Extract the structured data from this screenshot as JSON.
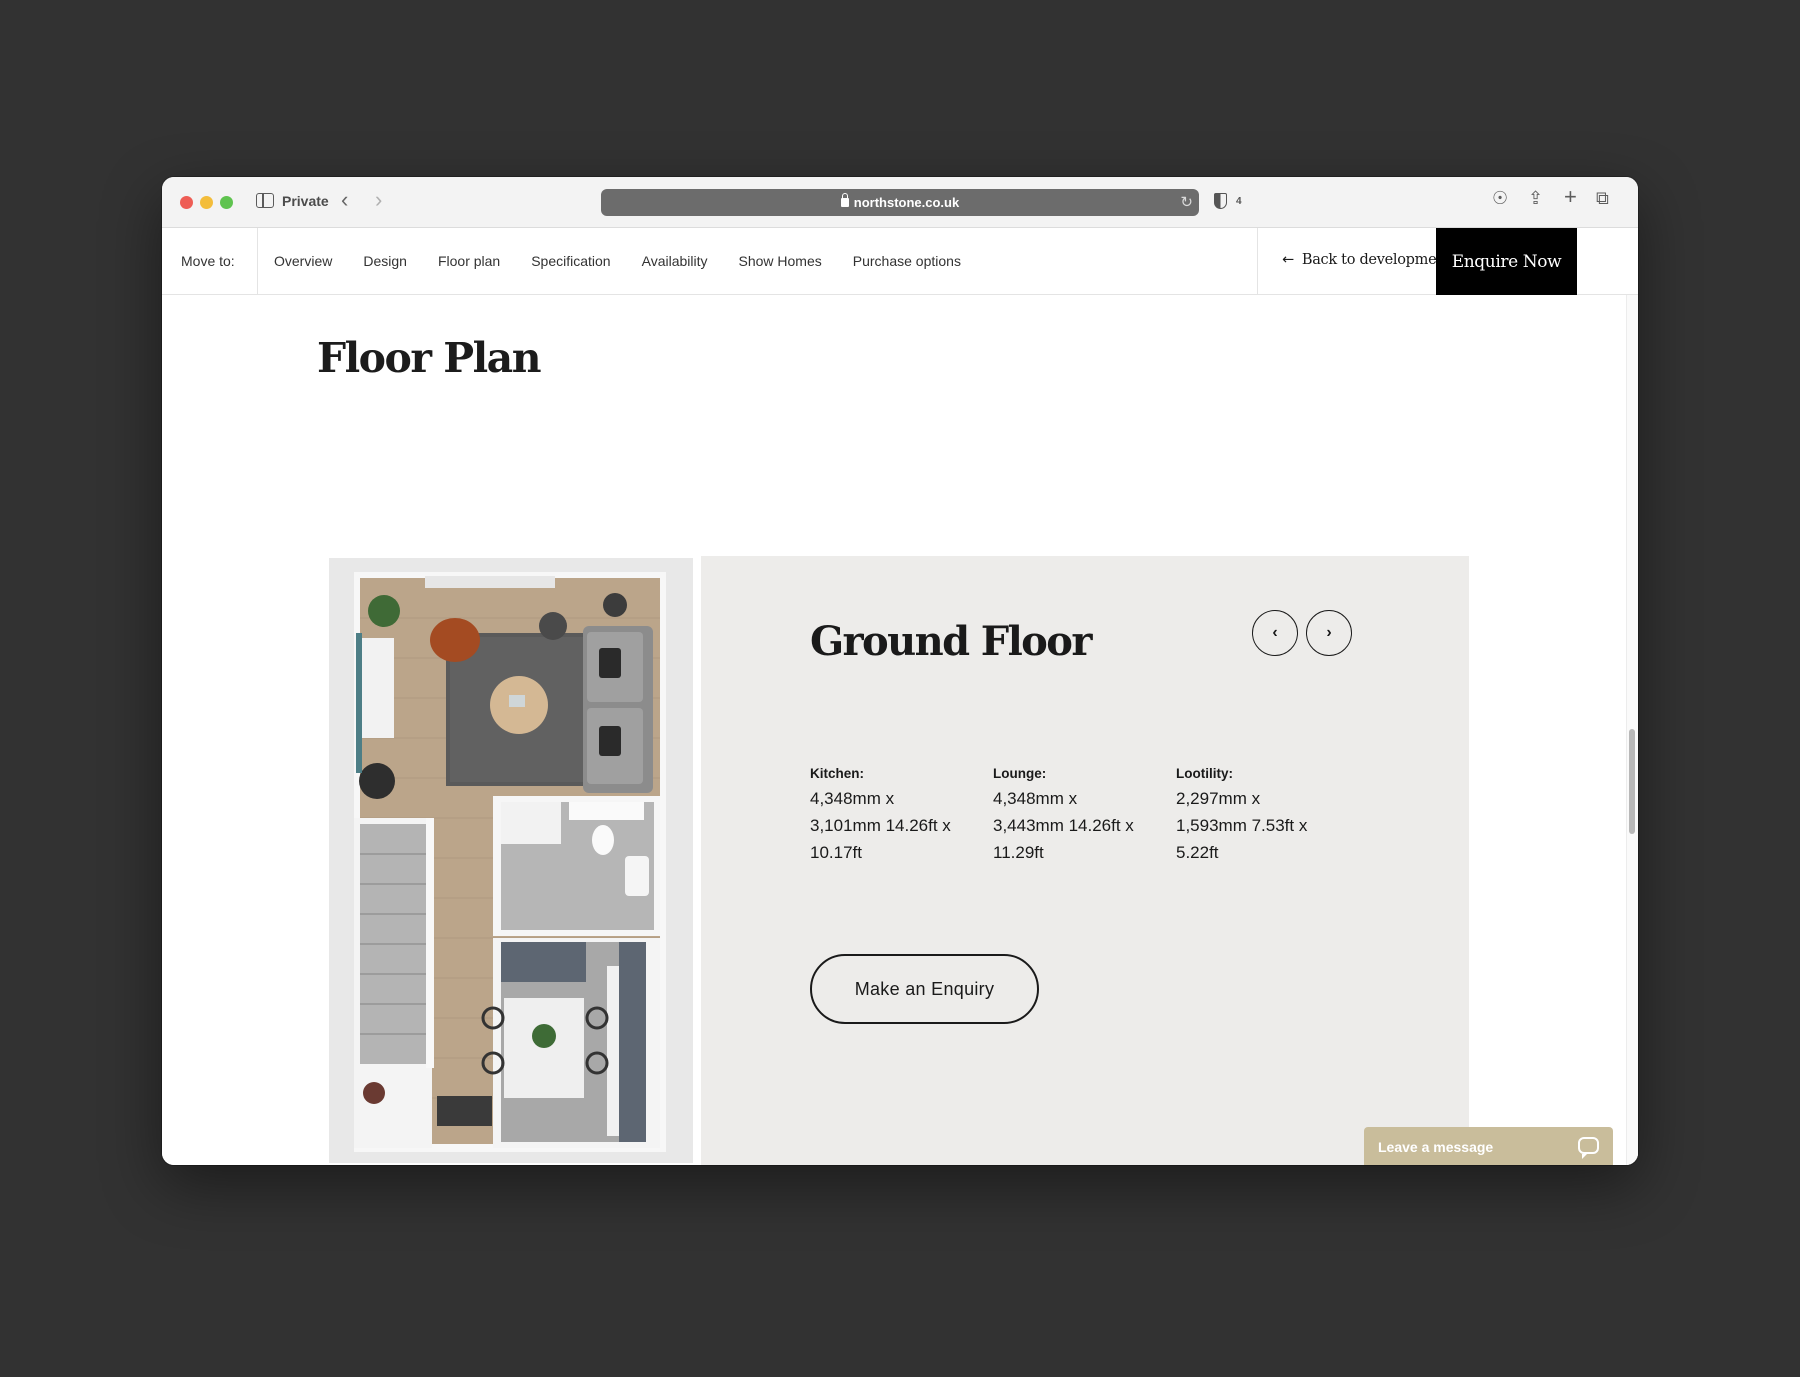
{
  "browser": {
    "private_label": "Private",
    "url": "northstone.co.uk",
    "shield_count": "4"
  },
  "nav": {
    "move_to": "Move to:",
    "items": [
      "Overview",
      "Design",
      "Floor plan",
      "Specification",
      "Availability",
      "Show Homes",
      "Purchase options"
    ],
    "back_label": "Back to development",
    "enquire_label": "Enquire Now"
  },
  "main": {
    "title": "Floor Plan",
    "floor": {
      "name": "Ground Floor",
      "rooms": [
        {
          "label": "Kitchen:",
          "dims": "4,348mm x 3,101mm 14.26ft x 10.17ft"
        },
        {
          "label": "Lounge:",
          "dims": "4,348mm x 3,443mm 14.26ft x 11.29ft"
        },
        {
          "label": "Lootility:",
          "dims": "2,297mm x 1,593mm 7.53ft x 5.22ft"
        }
      ],
      "enquiry_label": "Make an Enquiry"
    }
  },
  "chat": {
    "label": "Leave a message"
  },
  "colors": {
    "panel_bg": "#edecea",
    "chat_bg": "#c9bd9b",
    "enquire_bg": "#000000"
  }
}
